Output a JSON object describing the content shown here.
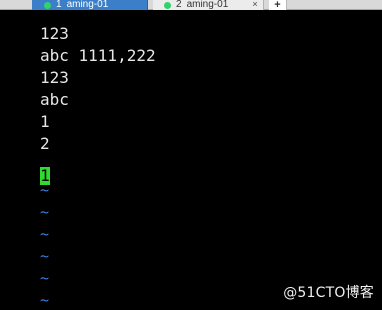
{
  "tabs": [
    {
      "number": "1",
      "title": "aming-01"
    },
    {
      "number": "2",
      "title": "aming-01",
      "close": "×"
    }
  ],
  "tab_add": "+",
  "terminal": {
    "lines": [
      "123",
      "abc 1111,222",
      "123",
      "abc",
      "1",
      "2"
    ],
    "cursor_text": "1",
    "empty_marker": "~"
  },
  "watermark": "@51CTO博客",
  "colors": {
    "active_tab": "#3a7fc7",
    "cursor": "#2ddc2f",
    "tilde": "#3d7bd8",
    "status_dot": "#31d16e"
  }
}
